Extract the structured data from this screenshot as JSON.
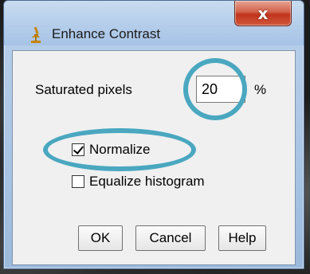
{
  "window": {
    "title": "Enhance Contrast",
    "close_glyph": "x",
    "app_icon": "microscope-icon"
  },
  "form": {
    "saturated_label": "Saturated pixels",
    "saturated_value": "20",
    "percent_label": "%",
    "normalize_label": "Normalize",
    "normalize_checked": true,
    "equalize_label": "Equalize histogram",
    "equalize_checked": false
  },
  "buttons": {
    "ok": "OK",
    "cancel": "Cancel",
    "help": "Help"
  },
  "colors": {
    "highlight": "#4aa7c0",
    "close_button": "#c0351d",
    "titlebar": "#b4cdea"
  }
}
